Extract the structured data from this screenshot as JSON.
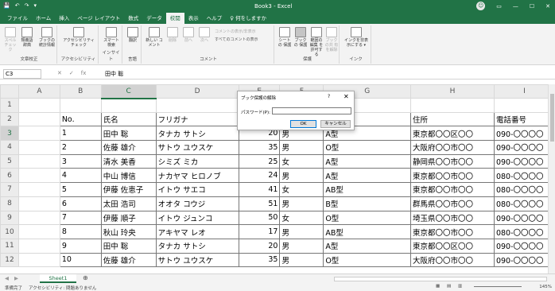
{
  "titlebar": {
    "title": "Book3 - Excel",
    "quick_access": [
      "💾",
      "↶",
      "↷",
      "▾"
    ],
    "avatar": "☺"
  },
  "menu": {
    "tabs": [
      "ファイル",
      "ホーム",
      "挿入",
      "ページ レイアウト",
      "数式",
      "データ",
      "校閲",
      "表示",
      "ヘルプ",
      "♀ 何をしますか"
    ],
    "active_index": 6
  },
  "ribbon": {
    "groups": [
      {
        "label": "文章校正",
        "buttons": [
          "スペル チェック",
          "類義語 辞典",
          "ブックの統計情報"
        ]
      },
      {
        "label": "アクセシビリティ",
        "buttons": [
          "アクセシビリティ チェック"
        ]
      },
      {
        "label": "インサイト",
        "buttons": [
          "スマート 検索"
        ]
      },
      {
        "label": "言語",
        "buttons": [
          "翻訳"
        ]
      },
      {
        "label": "コメント",
        "buttons": [
          "新しい コメント",
          "削除",
          "前へ",
          "次へ"
        ],
        "small": [
          "コメントの表示/非表示",
          "すべてのコメントの表示"
        ]
      },
      {
        "label": "保護",
        "buttons": [
          "シートの 保護",
          "ブックの 保護",
          "範囲の編集 を許可する",
          "ブックの共 有を解除"
        ]
      },
      {
        "label": "インク",
        "buttons": [
          "インクを非表 示にする ▾"
        ]
      }
    ]
  },
  "formula": {
    "namebox": "C3",
    "icons": [
      "✕",
      "✓",
      "fx"
    ],
    "value": "田中 聡"
  },
  "grid": {
    "columns": [
      "A",
      "B",
      "C",
      "D",
      "E",
      "F",
      "G",
      "H",
      "I"
    ],
    "header_row": [
      "",
      "No.",
      "氏名",
      "フリガナ",
      "",
      "",
      "",
      "住所",
      "電話番号"
    ],
    "rows": [
      [
        "1",
        "田中 聡",
        "タナカ サトシ",
        "20",
        "男",
        "A型",
        "東京都〇〇区〇〇",
        "090-〇〇〇〇"
      ],
      [
        "2",
        "佐藤 雄介",
        "サトウ ユウスケ",
        "35",
        "男",
        "O型",
        "大阪府〇〇市〇〇",
        "090-〇〇〇〇"
      ],
      [
        "3",
        "清水 美香",
        "シミズ ミカ",
        "25",
        "女",
        "A型",
        "静岡県〇〇市〇〇",
        "090-〇〇〇〇"
      ],
      [
        "4",
        "中山 博信",
        "ナカヤマ ヒロノブ",
        "24",
        "男",
        "A型",
        "東京都〇〇市〇〇",
        "080-〇〇〇〇"
      ],
      [
        "5",
        "伊藤 佐恵子",
        "イトウ サエコ",
        "41",
        "女",
        "AB型",
        "東京都〇〇市〇〇",
        "080-〇〇〇〇"
      ],
      [
        "6",
        "太田 浩司",
        "オオタ コウジ",
        "51",
        "男",
        "B型",
        "群馬県〇〇市〇〇",
        "080-〇〇〇〇"
      ],
      [
        "7",
        "伊藤 順子",
        "イトウ ジュンコ",
        "50",
        "女",
        "O型",
        "埼玉県〇〇市〇〇",
        "090-〇〇〇〇"
      ],
      [
        "8",
        "秋山 玲央",
        "アキヤマ レオ",
        "17",
        "男",
        "AB型",
        "東京都〇〇市〇〇",
        "080-〇〇〇〇"
      ],
      [
        "9",
        "田中 聡",
        "タナカ サトシ",
        "20",
        "男",
        "A型",
        "東京都〇〇区〇〇",
        "090-〇〇〇〇"
      ],
      [
        "10",
        "佐藤 雄介",
        "サトウ ユウスケ",
        "35",
        "男",
        "O型",
        "大阪府〇〇市〇〇",
        "090-〇〇〇〇"
      ]
    ]
  },
  "dialog": {
    "title": "ブック保護の解除",
    "help": "?",
    "close": "✕",
    "password_label": "パスワード(P):",
    "ok": "OK",
    "cancel": "キャンセル"
  },
  "sheets": {
    "active": "Sheet1",
    "add": "⊕",
    "nav": [
      "◀",
      "▶"
    ]
  },
  "status": {
    "left": "準備完了",
    "accessibility": "アクセシビリティ: 問題ありません",
    "zoom": "145%"
  }
}
